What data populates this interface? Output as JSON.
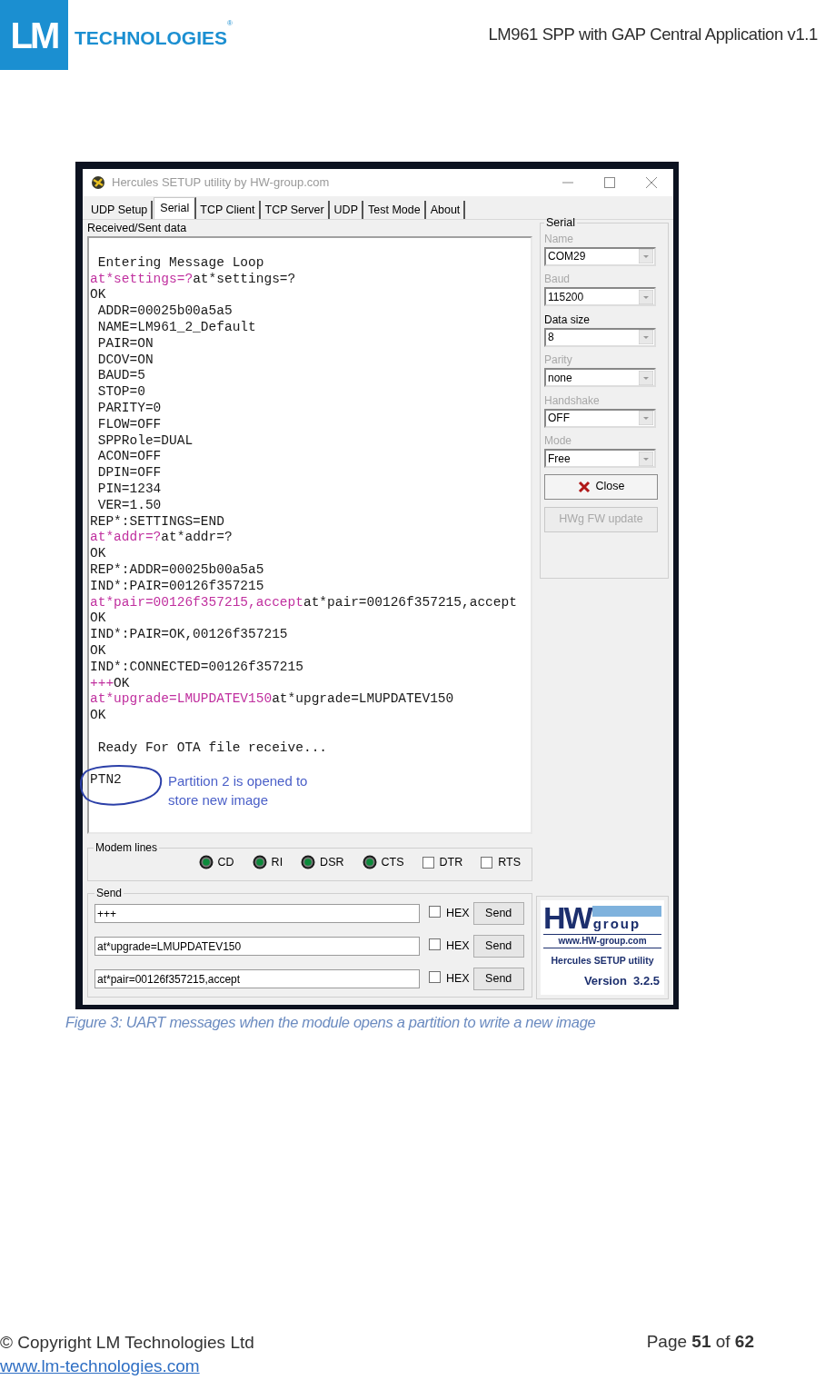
{
  "header": {
    "logo_mark": "LM",
    "logo_text": "TECHNOLOGIES",
    "logo_registered": "®",
    "doc_title": "LM961 SPP with GAP Central Application v1.1"
  },
  "window": {
    "title": "Hercules SETUP utility by HW-group.com",
    "tabs": [
      {
        "label": "UDP Setup",
        "selected": false
      },
      {
        "label": "Serial",
        "selected": true
      },
      {
        "label": "TCP Client",
        "selected": false
      },
      {
        "label": "TCP Server",
        "selected": false
      },
      {
        "label": "UDP",
        "selected": false
      },
      {
        "label": "Test Mode",
        "selected": false
      },
      {
        "label": "About",
        "selected": false
      }
    ],
    "received_label": "Received/Sent data",
    "terminal": {
      "lines": [
        {
          "kind": "blank"
        },
        {
          "segments": [
            {
              "text": " Entering Message Loop",
              "kind": "received"
            }
          ]
        },
        {
          "segments": [
            {
              "text": "at*settings=?",
              "kind": "sent"
            },
            {
              "text": "at*settings=?",
              "kind": "received"
            }
          ]
        },
        {
          "segments": [
            {
              "text": "OK",
              "kind": "received"
            }
          ]
        },
        {
          "segments": [
            {
              "text": " ADDR=00025b00a5a5",
              "kind": "received"
            }
          ]
        },
        {
          "segments": [
            {
              "text": " NAME=LM961_2_Default",
              "kind": "received"
            }
          ]
        },
        {
          "segments": [
            {
              "text": " PAIR=ON",
              "kind": "received"
            }
          ]
        },
        {
          "segments": [
            {
              "text": " DCOV=ON",
              "kind": "received"
            }
          ]
        },
        {
          "segments": [
            {
              "text": " BAUD=5",
              "kind": "received"
            }
          ]
        },
        {
          "segments": [
            {
              "text": " STOP=0",
              "kind": "received"
            }
          ]
        },
        {
          "segments": [
            {
              "text": " PARITY=0",
              "kind": "received"
            }
          ]
        },
        {
          "segments": [
            {
              "text": " FLOW=OFF",
              "kind": "received"
            }
          ]
        },
        {
          "segments": [
            {
              "text": " SPPRole=DUAL",
              "kind": "received"
            }
          ]
        },
        {
          "segments": [
            {
              "text": " ACON=OFF",
              "kind": "received"
            }
          ]
        },
        {
          "segments": [
            {
              "text": " DPIN=OFF",
              "kind": "received"
            }
          ]
        },
        {
          "segments": [
            {
              "text": " PIN=1234",
              "kind": "received"
            }
          ]
        },
        {
          "segments": [
            {
              "text": " VER=1.50",
              "kind": "received"
            }
          ]
        },
        {
          "segments": [
            {
              "text": "REP*:SETTINGS=END",
              "kind": "received"
            }
          ]
        },
        {
          "segments": [
            {
              "text": "at*addr=?",
              "kind": "sent"
            },
            {
              "text": "at*addr=?",
              "kind": "received"
            }
          ]
        },
        {
          "segments": [
            {
              "text": "OK",
              "kind": "received"
            }
          ]
        },
        {
          "segments": [
            {
              "text": "REP*:ADDR=00025b00a5a5",
              "kind": "received"
            }
          ]
        },
        {
          "segments": [
            {
              "text": "IND*:PAIR=00126f357215",
              "kind": "received"
            }
          ]
        },
        {
          "segments": [
            {
              "text": "at*pair=00126f357215,accept",
              "kind": "sent"
            },
            {
              "text": "at*pair=00126f357215,accept",
              "kind": "received"
            }
          ]
        },
        {
          "segments": [
            {
              "text": "OK",
              "kind": "received"
            }
          ]
        },
        {
          "segments": [
            {
              "text": "IND*:PAIR=OK,00126f357215",
              "kind": "received"
            }
          ]
        },
        {
          "segments": [
            {
              "text": "OK",
              "kind": "received"
            }
          ]
        },
        {
          "segments": [
            {
              "text": "IND*:CONNECTED=00126f357215",
              "kind": "received"
            }
          ]
        },
        {
          "segments": [
            {
              "text": "+++",
              "kind": "sent"
            },
            {
              "text": "OK",
              "kind": "received"
            }
          ]
        },
        {
          "segments": [
            {
              "text": "at*upgrade=LMUPDATEV150",
              "kind": "sent"
            },
            {
              "text": "at*upgrade=LMUPDATEV150",
              "kind": "received"
            }
          ]
        },
        {
          "segments": [
            {
              "text": "OK",
              "kind": "received"
            }
          ]
        },
        {
          "kind": "blank"
        },
        {
          "segments": [
            {
              "text": " Ready For OTA file receive...",
              "kind": "received"
            }
          ]
        },
        {
          "kind": "blank"
        },
        {
          "segments": [
            {
              "text": "PTN2",
              "kind": "received"
            }
          ]
        }
      ],
      "annotation": "Partition 2 is opened to store new image"
    },
    "serial": {
      "title": "Serial",
      "fields": [
        {
          "label": "Name",
          "value": "COM29",
          "disabled": true
        },
        {
          "label": "Baud",
          "value": "115200",
          "disabled": true
        },
        {
          "label": "Data size",
          "value": "8",
          "disabled": false
        },
        {
          "label": "Parity",
          "value": "none",
          "disabled": true
        },
        {
          "label": "Handshake",
          "value": "OFF",
          "disabled": true
        },
        {
          "label": "Mode",
          "value": "Free",
          "disabled": true
        }
      ],
      "buttons": [
        {
          "label": "Close",
          "kind": "close",
          "disabled": false
        },
        {
          "label": "HWg FW update",
          "kind": "plain",
          "disabled": true
        }
      ]
    },
    "modem_lines": {
      "title": "Modem lines",
      "leds": [
        {
          "label": "CD",
          "on": true
        },
        {
          "label": "RI",
          "on": true
        },
        {
          "label": "DSR",
          "on": true
        },
        {
          "label": "CTS",
          "on": true
        }
      ],
      "checks": [
        {
          "label": "DTR",
          "checked": false
        },
        {
          "label": "RTS",
          "checked": false
        }
      ]
    },
    "send": {
      "title": "Send",
      "rows": [
        {
          "value": "+++",
          "hex_label": "HEX",
          "hex": false,
          "button": "Send"
        },
        {
          "value": "at*upgrade=LMUPDATEV150",
          "hex_label": "HEX",
          "hex": false,
          "button": "Send"
        },
        {
          "value": "at*pair=00126f357215,accept",
          "hex_label": "HEX",
          "hex": false,
          "button": "Send"
        }
      ]
    },
    "hw_logo": {
      "mark": "HW",
      "group": "group",
      "url": "www.HW-group.com",
      "product": "Hercules SETUP utility",
      "version": "Version  3.2.5"
    }
  },
  "caption": "Figure 3: UART messages when the module opens a partition to write a new image",
  "footer": {
    "copyright": "© Copyright LM Technologies Ltd",
    "website": "www.lm-technologies.com",
    "page": "Page **51** of **62**"
  }
}
